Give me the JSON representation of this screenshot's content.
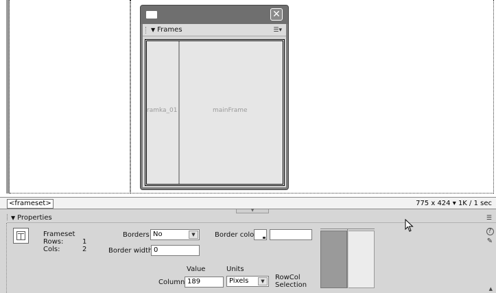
{
  "frames_panel": {
    "title": "Frames",
    "close_glyph": "✕",
    "left_frame": "ramka_01",
    "right_frame": "mainFrame"
  },
  "status_bar": {
    "tag_selector": "<frameset>",
    "window_size": "775 x 424",
    "size_arrow": "▾",
    "download": "1K / 1 sec"
  },
  "properties": {
    "title": "Properties",
    "selection_type": "Frameset",
    "rows_label": "Rows:",
    "rows_value": "1",
    "cols_label": "Cols:",
    "cols_value": "2",
    "borders_label": "Borders",
    "borders_value": "No",
    "border_color_label": "Border color",
    "border_color_value": "",
    "border_width_label": "Border width",
    "border_width_value": "0",
    "value_header": "Value",
    "units_header": "Units",
    "column_label": "Column",
    "column_value": "189",
    "units_value": "Pixels",
    "rowcol_label_1": "RowCol",
    "rowcol_label_2": "Selection",
    "help_glyph": "?",
    "edit_glyph": "✎"
  },
  "icons": {
    "panel_menu": "panel-options-icon",
    "window": "window-icon",
    "dropdown": "chevron-down-icon",
    "frameset": "frameset-icon",
    "cursor": "mouse-pointer-icon"
  },
  "colors": {
    "panel_bg": "#d6d6d6",
    "float_titlebar": "#6f6f6f",
    "selected_column": "#9a9a9a"
  }
}
